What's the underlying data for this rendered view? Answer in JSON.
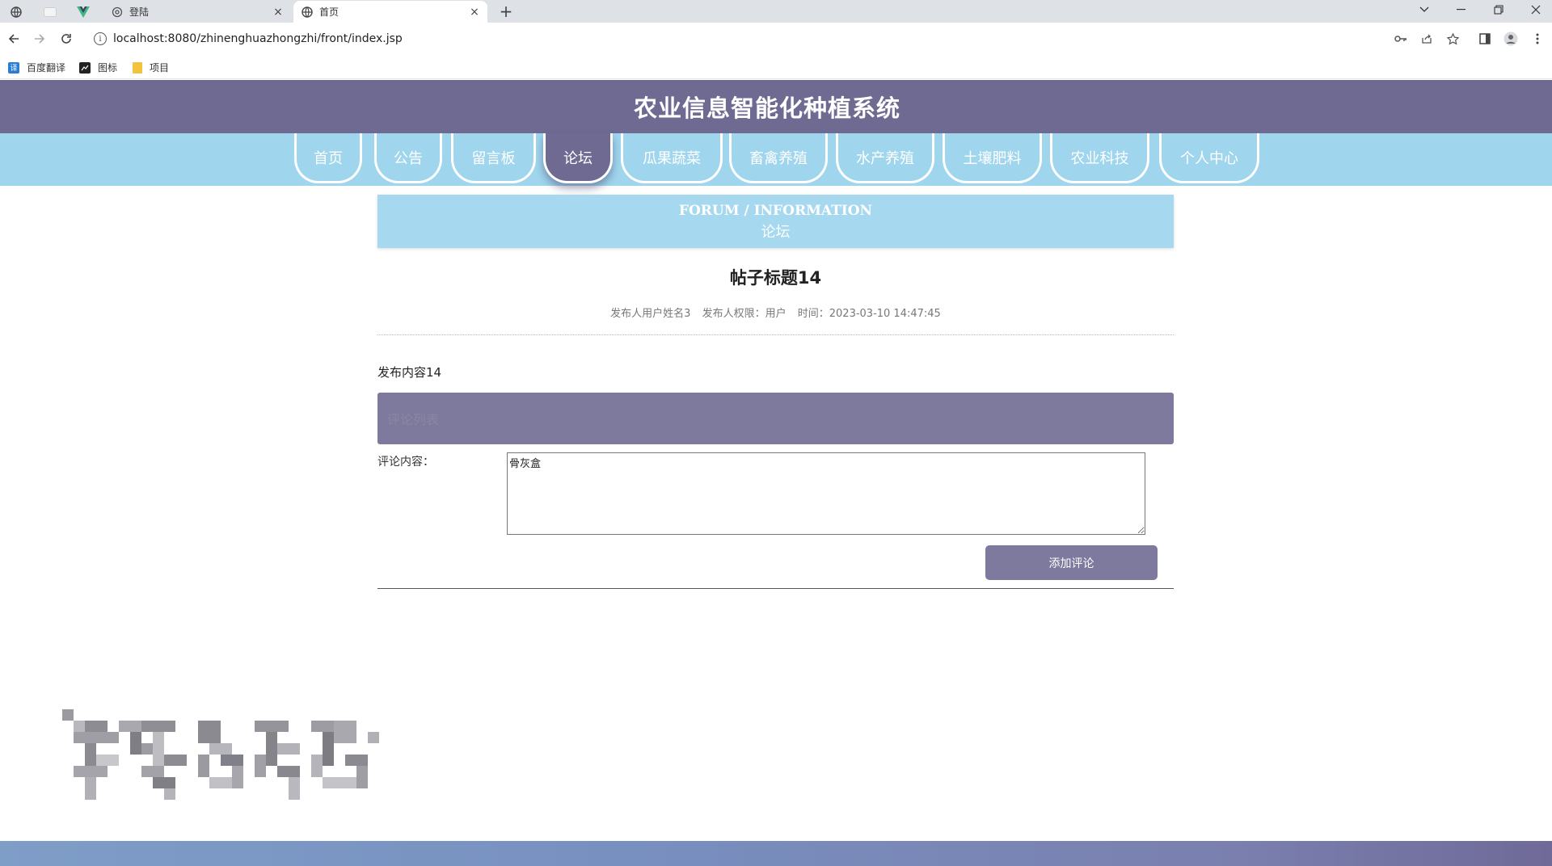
{
  "browser": {
    "tabs": [
      {
        "title": "登陆",
        "close": "×"
      },
      {
        "title": "首页",
        "close": "×"
      }
    ],
    "new_tab": "+",
    "url": "localhost:8080/zhinenghuazhongzhi/front/index.jsp",
    "bookmarks": [
      {
        "label": "百度翻译",
        "color": "#2b7cd3"
      },
      {
        "label": "图标",
        "color": "#222222"
      },
      {
        "label": "项目",
        "color": "#f3c33b"
      }
    ]
  },
  "site": {
    "title": "农业信息智能化种植系统",
    "nav": [
      "首页",
      "公告",
      "留言板",
      "论坛",
      "瓜果蔬菜",
      "畜禽养殖",
      "水产养殖",
      "土壤肥料",
      "农业科技",
      "个人中心"
    ],
    "active_nav": "论坛"
  },
  "banner": {
    "en": "FORUM / INFORMATION",
    "cn": "论坛"
  },
  "post": {
    "title": "帖子标题14",
    "author": "发布人用户姓名3",
    "role": "发布人权限：用户",
    "time": "时间：2023-03-10 14:47:45",
    "content": "发布内容14"
  },
  "comments": {
    "header": "评论列表",
    "label": "评论内容：",
    "input_value": "骨灰盒",
    "submit_label": "添加评论"
  },
  "colors": {
    "header_purple": "#6e6a92",
    "nav_blue": "#9fd6ee",
    "banner_blue": "#a6d8ef",
    "button_purple": "#7e7a9e"
  }
}
